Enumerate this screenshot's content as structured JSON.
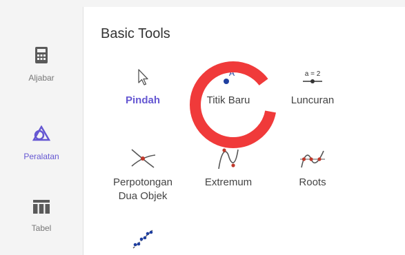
{
  "sidebar": {
    "items": [
      {
        "label": "Aljabar",
        "icon": "calculator-icon"
      },
      {
        "label": "Peralatan",
        "icon": "tools-icon"
      },
      {
        "label": "Tabel",
        "icon": "table-icon"
      }
    ],
    "active_index": 1
  },
  "main": {
    "section_title": "Basic Tools",
    "tools": [
      {
        "label": "Pindah",
        "icon": "cursor-icon",
        "active": true
      },
      {
        "label": "Titik Baru",
        "icon": "point-icon",
        "icon_text": "A"
      },
      {
        "label": "Luncuran",
        "icon": "slider-icon",
        "icon_text": "a = 2"
      },
      {
        "label": "Perpotongan\nDua Objek",
        "icon": "intersect-icon"
      },
      {
        "label": "Extremum",
        "icon": "extremum-icon"
      },
      {
        "label": "Roots",
        "icon": "roots-icon"
      },
      {
        "label": "",
        "icon": "fit-line-icon"
      }
    ],
    "highlight_tool": "Titik Baru"
  },
  "colors": {
    "accent": "#6557d2",
    "highlight_ring": "#f03a3a",
    "point": "#1f3fa0",
    "point_red": "#c0392b",
    "sidebar_bg": "#f4f4f4"
  }
}
